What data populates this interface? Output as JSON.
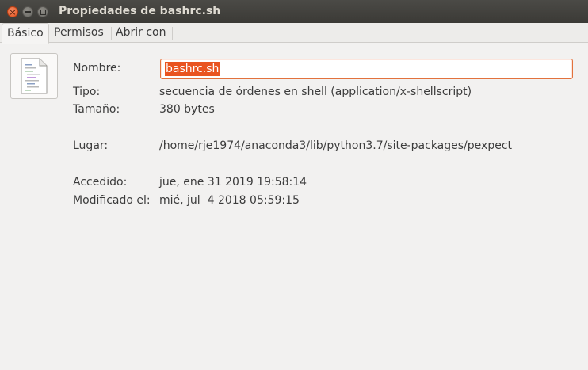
{
  "window": {
    "title": "Propiedades de bashrc.sh",
    "close_glyph": "×",
    "min_icon": "minimize-icon",
    "max_icon": "maximize-icon"
  },
  "tabs": [
    {
      "label": "Básico",
      "active": true
    },
    {
      "label": "Permisos",
      "active": false
    },
    {
      "label": "Abrir con",
      "active": false
    }
  ],
  "file_icon": "shell-script-file-icon",
  "fields": {
    "name": {
      "label": "Nombre:",
      "value": "bashrc.sh"
    },
    "type": {
      "label": "Tipo:",
      "value": "secuencia de órdenes en shell (application/x-shellscript)"
    },
    "size": {
      "label": "Tamaño:",
      "value": "380 bytes"
    },
    "location": {
      "label": "Lugar:",
      "value": "/home/rje1974/anaconda3/lib/python3.7/site-packages/pexpect"
    },
    "accessed": {
      "label": "Accedido:",
      "value": "jue, ene 31 2019 19:58:14"
    },
    "modified": {
      "label": "Modificado el:",
      "value": "mié, jul  4 2018 05:59:15"
    }
  },
  "colors": {
    "accent": "#e95420",
    "titlebar": "#3b3a36",
    "background": "#f2f1f0"
  }
}
